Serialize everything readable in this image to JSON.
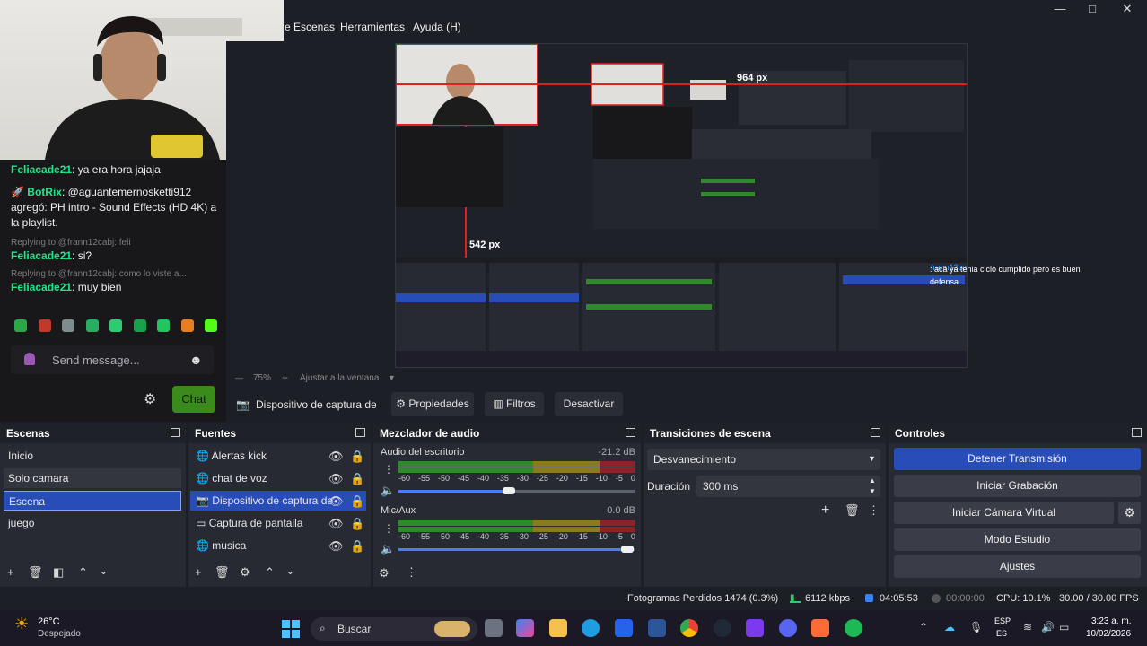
{
  "menu": {
    "escenas": "e Escenas",
    "herramientas": "Herramientas",
    "ayuda": "Ayuda (H)"
  },
  "window_controls": {
    "minimize": "—",
    "maximize": "□",
    "close": "✕"
  },
  "chat": {
    "messages": [
      {
        "user": "Feliacade21",
        "text": ": ya era hora jajaja"
      },
      {
        "user": "BotRix",
        "text": ": @aguantemernosketti912 agregó: PH intro - Sound Effects (HD 4K) a la playlist."
      },
      {
        "reply": "Replying to @frann12cabj: feli",
        "user": "Feliacade21",
        "text": ": si?"
      },
      {
        "reply": "Replying to @frann12cabj: como lo viste a...",
        "user": "Feliacade21",
        "text": ": muy bien"
      }
    ],
    "input_placeholder": "Send message...",
    "chat_button": "Chat"
  },
  "preview": {
    "px_label_1": "964 px",
    "px_label_2": "542 px",
    "overlay_chat_user": "frann12cabj",
    "overlay_chat_text": ": acá ya tenia ciclo cumplido pero es buen defensa",
    "zoom": "75%",
    "fit": "Ajustar a la ventana"
  },
  "source_toolbar": {
    "source_name": "Dispositivo de captura de v",
    "properties": "Propiedades",
    "filters": "Filtros",
    "deactivate": "Desactivar"
  },
  "scenes": {
    "title": "Escenas",
    "items": [
      "Inicio",
      "Solo camara",
      "Escena",
      "juego"
    ]
  },
  "sources": {
    "title": "Fuentes",
    "items": [
      "Alertas kick",
      "chat de voz",
      "Dispositivo de captura de",
      "Captura de pantalla",
      "musica"
    ]
  },
  "mixer": {
    "title": "Mezclador de audio",
    "channels": [
      {
        "name": "Audio del escritorio",
        "db": "-21.2 dB",
        "volume": 0.58
      },
      {
        "name": "Mic/Aux",
        "db": "0.0 dB",
        "volume": 1.0
      }
    ],
    "scale": [
      "-60",
      "-55",
      "-50",
      "-45",
      "-40",
      "-35",
      "-30",
      "-25",
      "-20",
      "-15",
      "-10",
      "-5",
      "0"
    ]
  },
  "transitions": {
    "title": "Transiciones de escena",
    "selected": "Desvanecimiento",
    "duration_label": "Duración",
    "duration_value": "300 ms"
  },
  "controls": {
    "title": "Controles",
    "buttons": [
      "Detener Transmisión",
      "Iniciar Grabación",
      "Iniciar Cámara Virtual",
      "Modo Estudio",
      "Ajustes"
    ]
  },
  "status": {
    "dropped": "Fotogramas Perdidos 1474 (0.3%)",
    "bitrate": "6112 kbps",
    "stream_time": "04:05:53",
    "rec_time": "00:00:00",
    "cpu": "CPU: 10.1%",
    "fps": "30.00 / 30.00 FPS"
  },
  "taskbar": {
    "weather_temp": "26°C",
    "weather_desc": "Despejado",
    "search": "Buscar",
    "lang_top": "ESP",
    "lang_bottom": "ES",
    "time": "3:23 a. m.",
    "date": "10/02/2026"
  },
  "colors": {
    "accent": "#284cb8",
    "chat_user": "#1fe68b",
    "kick_green": "#53fc18"
  }
}
